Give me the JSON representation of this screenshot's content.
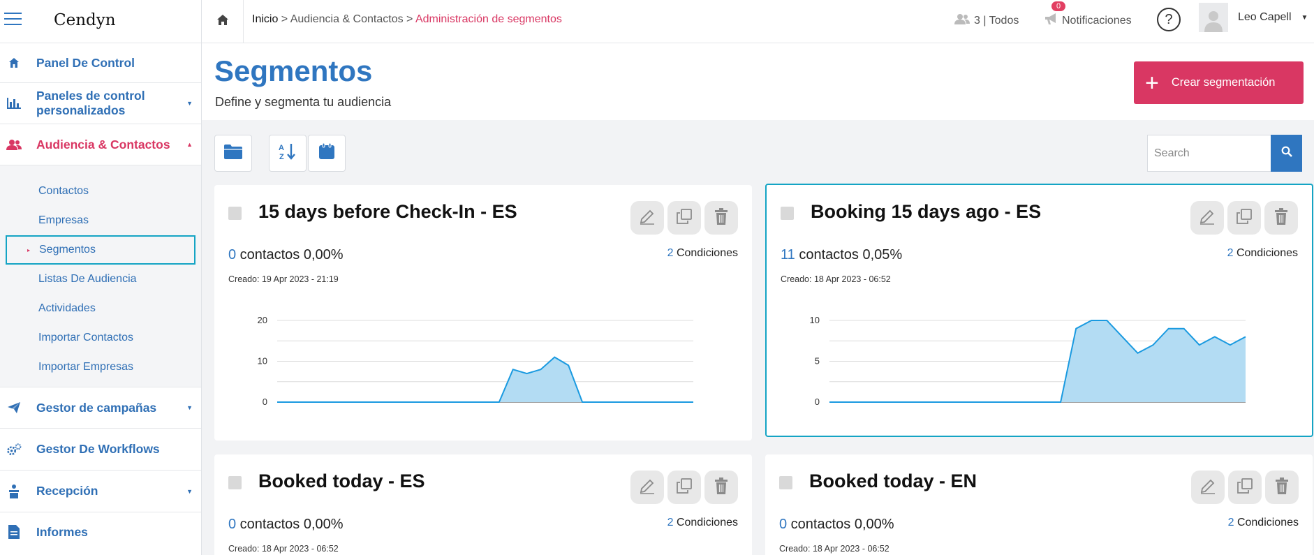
{
  "brand": {
    "logo_text": "Cendyn"
  },
  "sidebar": {
    "items": [
      {
        "label": "Panel De Control",
        "icon": "home-icon"
      },
      {
        "label": "Paneles de control personalizados",
        "icon": "bar-chart-icon"
      },
      {
        "label": "Audiencia & Contactos",
        "icon": "users-icon"
      },
      {
        "label": "Gestor de campañas",
        "icon": "paper-plane-icon"
      },
      {
        "label": "Gestor De Workflows",
        "icon": "gears-icon"
      },
      {
        "label": "Recepción",
        "icon": "reception-bell-icon"
      },
      {
        "label": "Informes",
        "icon": "document-icon"
      }
    ],
    "submenu": [
      {
        "label": "Contactos"
      },
      {
        "label": "Empresas"
      },
      {
        "label": "Segmentos"
      },
      {
        "label": "Listas De Audiencia"
      },
      {
        "label": "Actividades"
      },
      {
        "label": "Importar Contactos"
      },
      {
        "label": "Importar Empresas"
      }
    ]
  },
  "header": {
    "breadcrumb": {
      "home": "Inicio",
      "sep1": " > ",
      "level2": "Audiencia & Contactos",
      "sep2": " > ",
      "current": "Administración de segmentos"
    },
    "users": "3 | Todos",
    "notifications_label": "Notificaciones",
    "notifications_count": "0",
    "help": "?",
    "user_name": "Leo Capell"
  },
  "page": {
    "title": "Segmentos",
    "subtitle": "Define y segmenta tu audiencia",
    "create_button": "Crear segmentación",
    "search_placeholder": "Search"
  },
  "colors": {
    "brand_blue": "#2f76c0",
    "accent_pink": "#d93763",
    "highlight": "#14a4c4",
    "chart_fill": "#b3dcf3",
    "chart_line": "#1a9ae0"
  },
  "cards": [
    {
      "title": "15 days before Check-In - ES",
      "count": "0",
      "count_label": " contactos ",
      "percent": "0,00%",
      "conditions_count": "2",
      "conditions_label": " Condiciones",
      "created": "Creado: 19 Apr 2023 - 21:19",
      "chart_data": {
        "type": "area",
        "ylim": [
          0,
          20
        ],
        "yticks": [
          "0",
          "10",
          "20"
        ],
        "values": [
          0,
          0,
          0,
          0,
          0,
          0,
          0,
          0,
          0,
          0,
          0,
          0,
          0,
          0,
          0,
          0,
          0,
          8,
          7,
          8,
          11,
          9,
          0,
          0,
          0,
          0,
          0,
          0,
          0,
          0,
          0
        ]
      }
    },
    {
      "title": "Booking 15 days ago - ES",
      "count": "11",
      "count_label": " contactos ",
      "percent": "0,05%",
      "conditions_count": "2",
      "conditions_label": " Condiciones",
      "created": "Creado: 18 Apr 2023 - 06:52",
      "chart_data": {
        "type": "area",
        "ylim": [
          0,
          10
        ],
        "yticks": [
          "0",
          "5",
          "10"
        ],
        "values": [
          0,
          0,
          0,
          0,
          0,
          0,
          0,
          0,
          0,
          0,
          0,
          0,
          0,
          0,
          0,
          0,
          9,
          10,
          10,
          8,
          6,
          7,
          9,
          9,
          7,
          8,
          7,
          8
        ]
      }
    },
    {
      "title": "Booked today - ES",
      "count": "0",
      "count_label": " contactos ",
      "percent": "0,00%",
      "conditions_count": "2",
      "conditions_label": " Condiciones",
      "created": "Creado: 18 Apr 2023 - 06:52"
    },
    {
      "title": "Booked today - EN",
      "count": "0",
      "count_label": " contactos ",
      "percent": "0,00%",
      "conditions_count": "2",
      "conditions_label": " Condiciones",
      "created": "Creado: 18 Apr 2023 - 06:52"
    }
  ]
}
